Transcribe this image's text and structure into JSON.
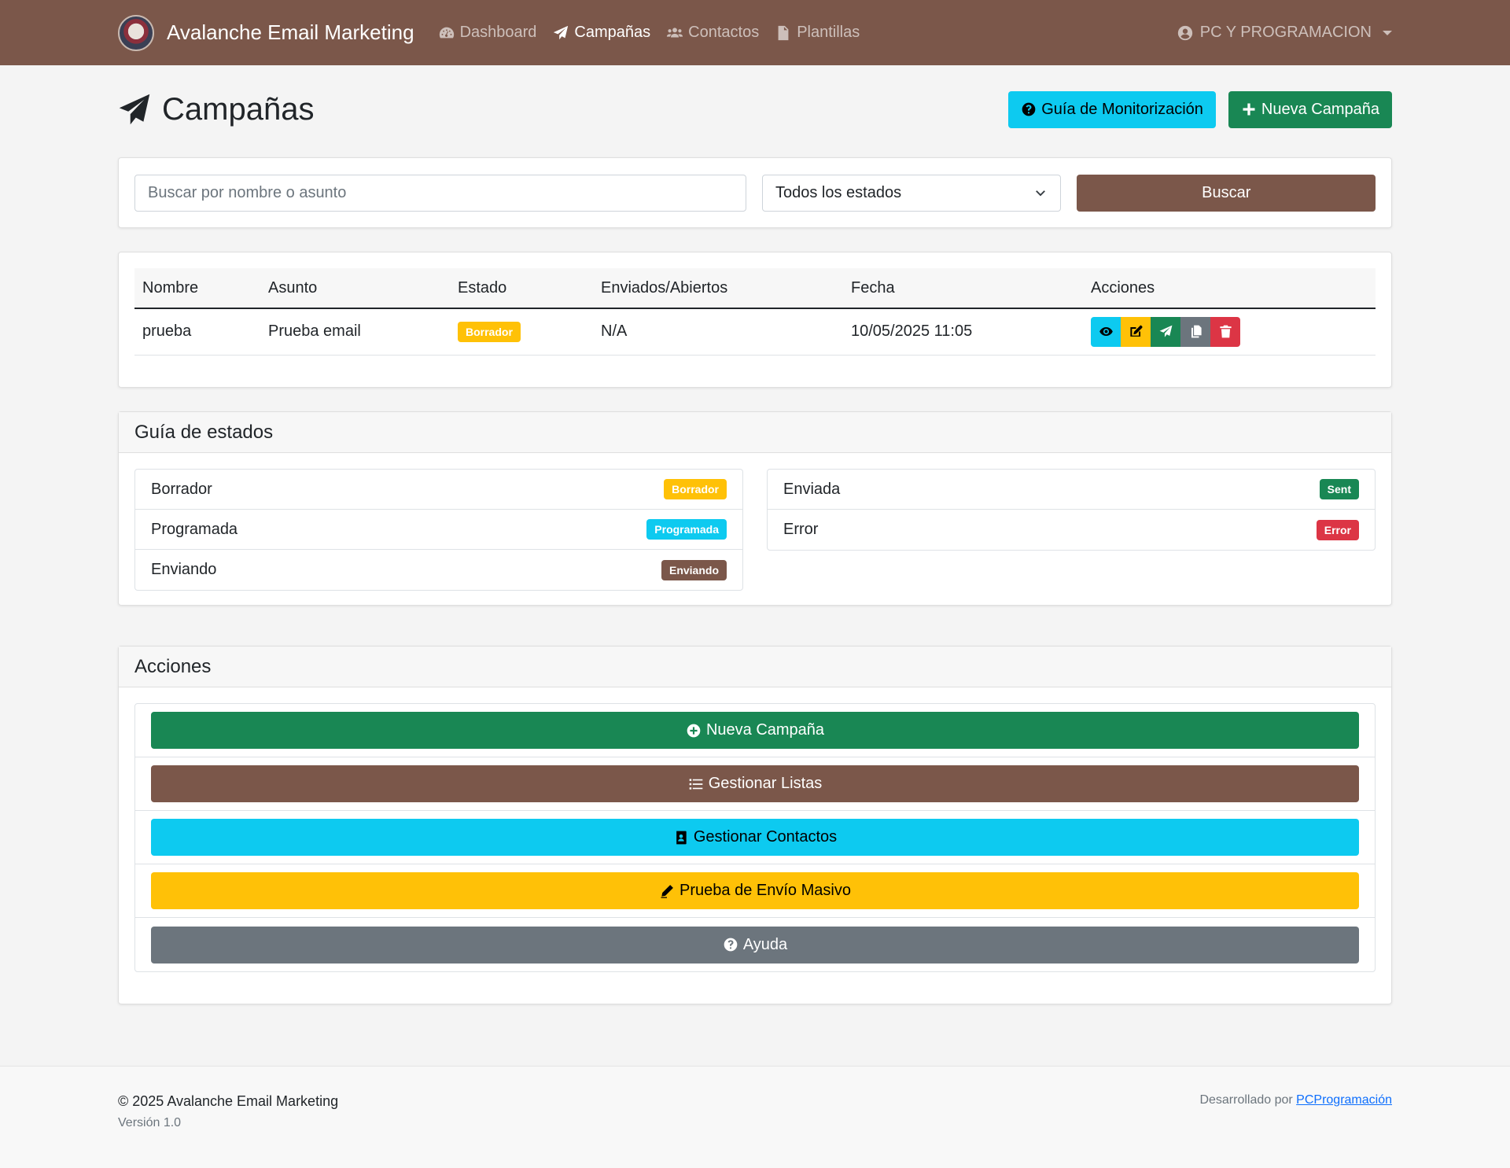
{
  "navbar": {
    "brand": "Avalanche Email Marketing",
    "items": [
      {
        "label": "Dashboard",
        "icon": "gauge-icon",
        "active": false
      },
      {
        "label": "Campañas",
        "icon": "paper-plane-icon",
        "active": true
      },
      {
        "label": "Contactos",
        "icon": "users-icon",
        "active": false
      },
      {
        "label": "Plantillas",
        "icon": "file-icon",
        "active": false
      }
    ],
    "user": "PC Y PROGRAMACION"
  },
  "header": {
    "title": "Campañas",
    "guide_button": "Guía de Monitorización",
    "new_button": "Nueva Campaña"
  },
  "search": {
    "placeholder": "Buscar por nombre o asunto",
    "value": "",
    "status_selected": "Todos los estados",
    "button": "Buscar"
  },
  "table": {
    "columns": [
      "Nombre",
      "Asunto",
      "Estado",
      "Enviados/Abiertos",
      "Fecha",
      "Acciones"
    ],
    "rows": [
      {
        "nombre": "prueba",
        "asunto": "Prueba email",
        "estado": "Borrador",
        "enviados": "N/A",
        "fecha": "10/05/2025 11:05"
      }
    ]
  },
  "guide": {
    "title": "Guía de estados",
    "left": [
      {
        "label": "Borrador",
        "badge": "Borrador",
        "color": "#ffc107"
      },
      {
        "label": "Programada",
        "badge": "Programada",
        "color": "#0dcaf0"
      },
      {
        "label": "Enviando",
        "badge": "Enviando",
        "color": "#7b574a"
      }
    ],
    "right": [
      {
        "label": "Enviada",
        "badge": "Sent",
        "color": "#198754"
      },
      {
        "label": "Error",
        "badge": "Error",
        "color": "#dc3545"
      }
    ]
  },
  "actions": {
    "title": "Acciones",
    "items": [
      {
        "label": "Nueva Campaña",
        "icon": "plus-circle-icon"
      },
      {
        "label": "Gestionar Listas",
        "icon": "list-icon"
      },
      {
        "label": "Gestionar Contactos",
        "icon": "address-book-icon"
      },
      {
        "label": "Prueba de Envío Masivo",
        "icon": "pen-icon"
      },
      {
        "label": "Ayuda",
        "icon": "question-circle-icon"
      }
    ]
  },
  "footer": {
    "copyright": "© 2025 Avalanche Email Marketing",
    "version": "Versión 1.0",
    "dev_prefix": "Desarrollado por ",
    "dev_link": "PCProgramación"
  },
  "colors": {
    "primary": "#7b574a",
    "info": "#0dcaf0",
    "success": "#198754",
    "warning": "#ffc107",
    "secondary": "#6c757d",
    "danger": "#dc3545"
  }
}
